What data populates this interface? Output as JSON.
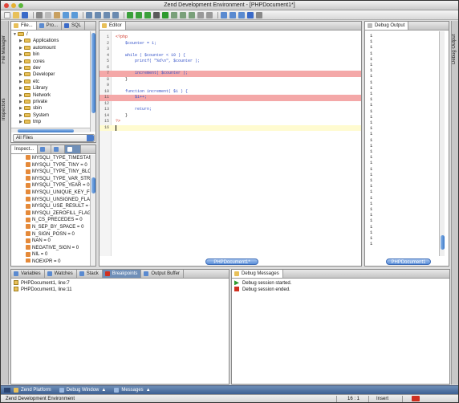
{
  "window": {
    "title": "Zend Development Environment - [PHPDocument1*]"
  },
  "side_tabs": {
    "left_top": "File Manager",
    "left_bottom": "Inspectors",
    "right": "Debug Output"
  },
  "file_manager": {
    "tabs": [
      "File...",
      "Pro...",
      "SQL"
    ],
    "tree": [
      "/",
      "Applications",
      "automount",
      "bin",
      "cores",
      "dev",
      "Developer",
      "etc",
      "Library",
      "Network",
      "private",
      "sbin",
      "System",
      "tmp"
    ],
    "filter": "All Files"
  },
  "inspector": {
    "tabs": [
      "Inspect...",
      "",
      ""
    ],
    "items": [
      "MYSQLI_TYPE_TIMESTAMP",
      "MYSQLI_TYPE_TINY = 0",
      "MYSQLI_TYPE_TINY_BLOB",
      "MYSQLI_TYPE_VAR_STRING",
      "MYSQLI_TYPE_YEAR = 0",
      "MYSQLI_UNIQUE_KEY_FLAG",
      "MYSQLI_UNSIGNED_FLAG",
      "MYSQLI_USE_RESULT = 0",
      "MYSQLI_ZEROFILL_FLAG =",
      "N_CS_PRECEDES = 0",
      "N_SEP_BY_SPACE = 0",
      "N_SIGN_POSN = 0",
      "NAN = 0",
      "NEGATIVE_SIGN = 0",
      "NIL = 0",
      "NOEXPR = 0"
    ]
  },
  "editor": {
    "tab": "Editor",
    "doc_label": "PHPDocument1*",
    "lines": [
      {
        "n": "1",
        "t": "<?php"
      },
      {
        "n": "2",
        "t": "    $counter = 1;"
      },
      {
        "n": "3",
        "t": ""
      },
      {
        "n": "4",
        "t": "    while ( $counter < 10 ) {"
      },
      {
        "n": "5",
        "t": "        printf( \"%d\\n\", $counter );"
      },
      {
        "n": "6",
        "t": ""
      },
      {
        "n": "7",
        "t": "        increment( $counter );"
      },
      {
        "n": "8",
        "t": "    }"
      },
      {
        "n": "9",
        "t": ""
      },
      {
        "n": "10",
        "t": "    function increment( $i ) {"
      },
      {
        "n": "11",
        "t": "        $i++;"
      },
      {
        "n": "12",
        "t": ""
      },
      {
        "n": "13",
        "t": "        return;"
      },
      {
        "n": "14",
        "t": "    }"
      },
      {
        "n": "15",
        "t": "?>"
      },
      {
        "n": "16",
        "t": ""
      }
    ]
  },
  "debug_output": {
    "tab": "Debug Output",
    "doc_label": "PHPDocument1",
    "lines": [
      "1",
      "1",
      "1",
      "1",
      "1",
      "1",
      "1",
      "1",
      "1",
      "1",
      "1",
      "1",
      "1",
      "1",
      "1",
      "1",
      "1",
      "1",
      "1",
      "1",
      "1",
      "1",
      "1",
      "1",
      "1",
      "1",
      "1",
      "1",
      "1",
      "1",
      "1",
      "1",
      "1",
      "1",
      "1",
      "1",
      "1"
    ]
  },
  "bottom_left": {
    "tabs": [
      "Variables",
      "Watches",
      "Stack",
      "Breakpoints",
      "Output Buffer"
    ],
    "active": "Breakpoints",
    "rows": [
      "PHPDocument1, line:7",
      "PHPDocument1, line:11"
    ]
  },
  "debug_messages": {
    "tab": "Debug Messages",
    "rows": [
      {
        "text": "Debug session started.",
        "color": "#2e9a2e"
      },
      {
        "text": "Debug session ended.",
        "color": "#d03020"
      }
    ]
  },
  "bottombar": {
    "items": [
      "Zend Platform",
      "Debug Window",
      "Messages"
    ]
  },
  "status": {
    "left": "Zend Development Environment",
    "pos": "16 : 1",
    "mode": "Insert"
  },
  "colors": {
    "breakpoint": "#f4a8a8",
    "current_line": "#fffbd0",
    "accent": "#3a78c8"
  }
}
